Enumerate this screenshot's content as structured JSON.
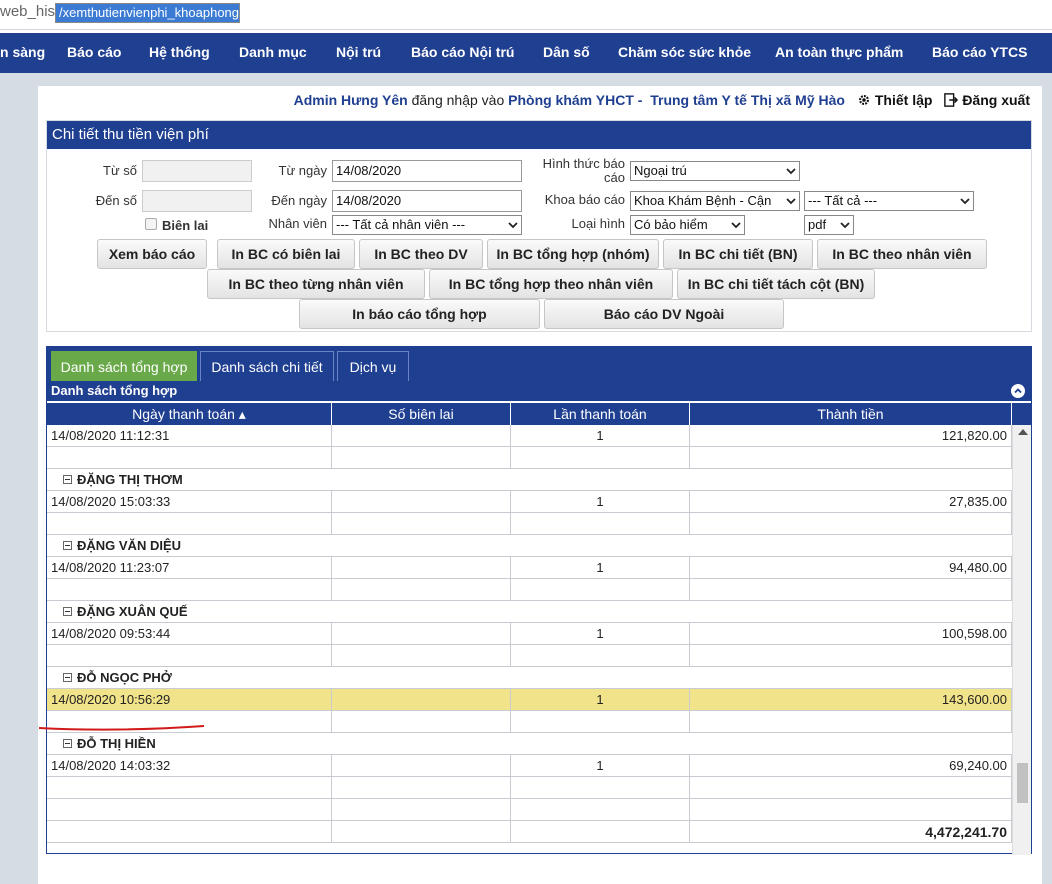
{
  "url": {
    "prefix": "web_his",
    "selected": "/xemthutienvienphi_khoaphong",
    "suffix": "#"
  },
  "nav": [
    "n sàng",
    "Báo cáo",
    "Hệ thống",
    "Danh mục",
    "Nội trú",
    "Báo cáo Nội trú",
    "Dân số",
    "Chăm sóc sức khỏe",
    "An toàn thực phẩm",
    "Báo cáo YTCS"
  ],
  "user": {
    "name": "Admin Hưng Yên",
    "login_text": "đăng nhập vào",
    "clinic": "Phòng khám YHCT -",
    "center": "Trung tâm Y tế Thị xã Mỹ Hào",
    "settings": "Thiết lập",
    "logout": "Đăng xuất"
  },
  "panel": {
    "title": "Chi tiết thu tiền viện phí",
    "tu_so_label": "Từ số",
    "den_so_label": "Đến số",
    "bien_lai_label": "Biên lai",
    "tu_ngay_label": "Từ ngày",
    "tu_ngay": "14/08/2020",
    "den_ngay_label": "Đến ngày",
    "den_ngay": "14/08/2020",
    "nhan_vien_label": "Nhân viên",
    "nhan_vien": "--- Tất cả nhân viên ---",
    "hinh_thuc_label_1": "Hình thức báo",
    "hinh_thuc_label_2": "cáo",
    "hinh_thuc": "Ngoại trú",
    "khoa_label": "Khoa báo cáo",
    "khoa": "Khoa Khám Bệnh - Cận",
    "khoa_sub": "--- Tất cả ---",
    "loai_hinh_label": "Loại hình",
    "loai_hinh": "Có bảo hiểm",
    "format": "pdf"
  },
  "buttons": {
    "b1": "Xem báo cáo",
    "b2": "In BC có biên lai",
    "b3": "In BC theo DV",
    "b4": "In BC tổng hợp (nhóm)",
    "b5": "In BC chi tiết (BN)",
    "b6": "In BC theo nhân viên",
    "b7": "In BC theo từng nhân viên",
    "b8": "In BC tổng hợp theo nhân viên",
    "b9": "In BC chi tiết tách cột (BN)",
    "b10": "In báo cáo tổng hợp",
    "b11": "Báo cáo DV Ngoài"
  },
  "tabs": [
    "Danh sách tổng hợp",
    "Danh sách chi tiết",
    "Dịch vụ"
  ],
  "grid": {
    "caption": "Danh sách tổng hợp",
    "headers": [
      "Ngày thanh toán ▴",
      "Số biên lai",
      "Lần thanh toán",
      "Thành tiền"
    ],
    "rows": [
      {
        "type": "data",
        "date": "14/08/2020 11:12:31",
        "receipt": "",
        "times": "1",
        "amount": "121,820.00"
      },
      {
        "type": "blank"
      },
      {
        "type": "group",
        "name": "ĐẶNG THỊ THƠM"
      },
      {
        "type": "data",
        "date": "14/08/2020 15:03:33",
        "receipt": "",
        "times": "1",
        "amount": "27,835.00"
      },
      {
        "type": "blank"
      },
      {
        "type": "group",
        "name": "ĐẶNG VĂN DIỆU"
      },
      {
        "type": "data",
        "date": "14/08/2020 11:23:07",
        "receipt": "",
        "times": "1",
        "amount": "94,480.00"
      },
      {
        "type": "blank"
      },
      {
        "type": "group",
        "name": "ĐẶNG XUÂN QUẾ"
      },
      {
        "type": "data",
        "date": "14/08/2020 09:53:44",
        "receipt": "",
        "times": "1",
        "amount": "100,598.00"
      },
      {
        "type": "blank"
      },
      {
        "type": "group",
        "name": "ĐỖ NGỌC PHỞ"
      },
      {
        "type": "data",
        "date": "14/08/2020 10:56:29",
        "receipt": "",
        "times": "1",
        "amount": "143,600.00",
        "highlight": true
      },
      {
        "type": "blank"
      },
      {
        "type": "group",
        "name": "ĐỖ THỊ HIỀN"
      },
      {
        "type": "data",
        "date": "14/08/2020 14:03:32",
        "receipt": "",
        "times": "1",
        "amount": "69,240.00"
      },
      {
        "type": "blank"
      },
      {
        "type": "blank"
      },
      {
        "type": "total",
        "amount": "4,472,241.70"
      }
    ]
  },
  "colors": {
    "navy": "#1f3f91",
    "active_tab": "#6aa94a",
    "highlight": "#f0e38a",
    "annotation": "#d21a1a"
  }
}
